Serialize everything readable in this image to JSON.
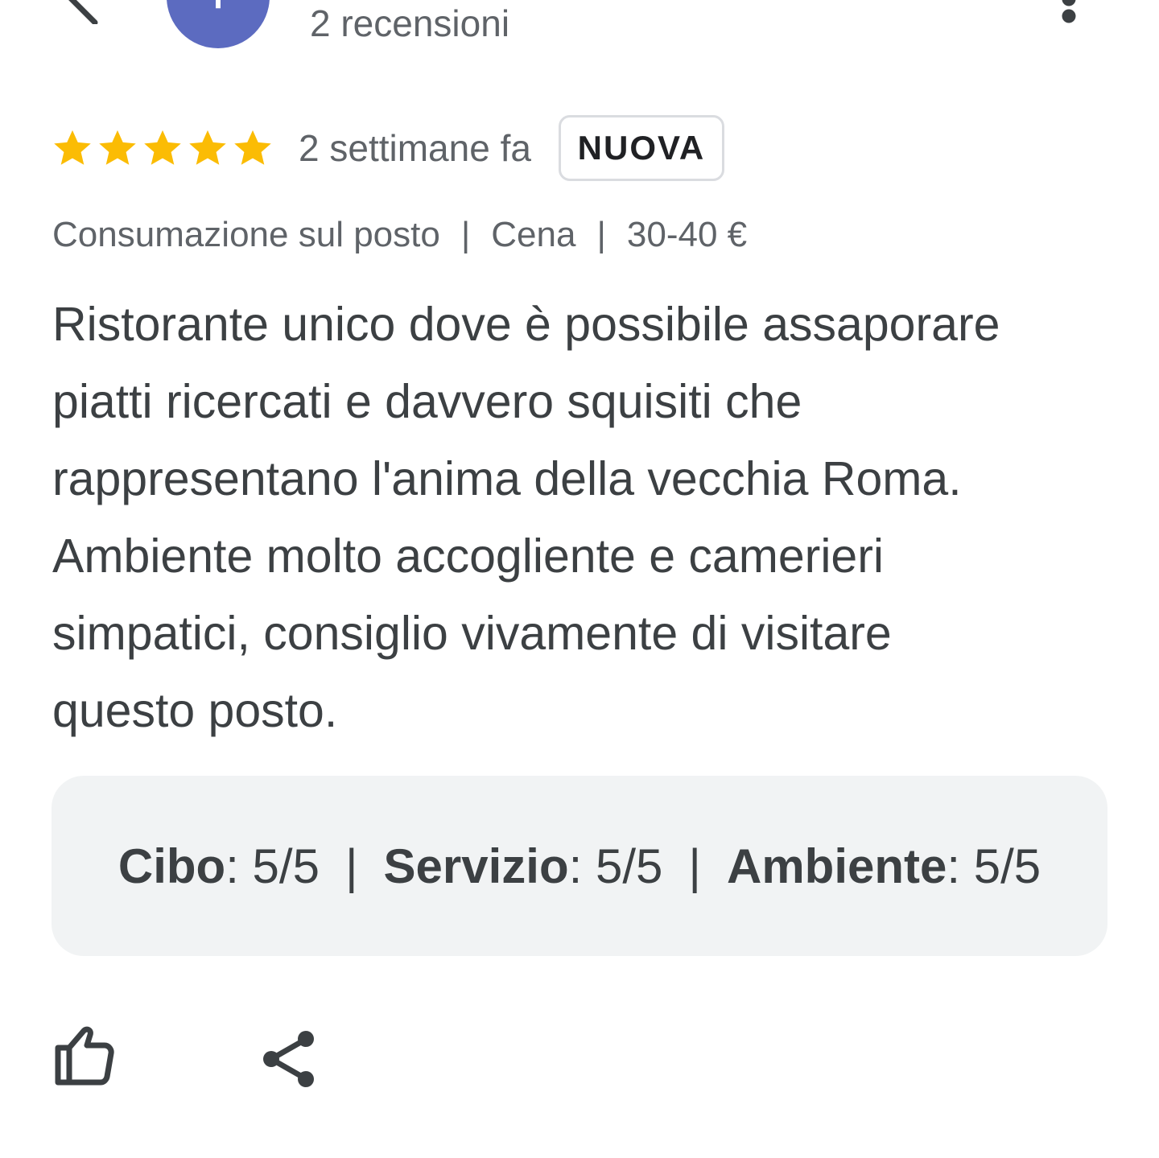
{
  "header": {
    "avatar_initial": "T",
    "reviews_count": "2 recensioni",
    "back_icon": "arrow-back-icon",
    "more_icon": "more-vertical-icon"
  },
  "review": {
    "rating": 5,
    "rating_max": 5,
    "star_color": "#fbbc04",
    "time_ago": "2 settimane fa",
    "badge": "NUOVA",
    "meta": {
      "service": "Consumazione sul posto",
      "meal": "Cena",
      "price": "30-40 €",
      "separator": "|"
    },
    "text": "Ristorante unico dove è possibile assaporare\npiatti ricercati e davvero squisiti che\nrappresentano l'anima della vecchia Roma.\nAmbiente molto accogliente e camerieri\nsimpatici, consiglio vivamente di visitare\nquesto posto.",
    "sub_ratings": {
      "food_label": "Cibo",
      "food_value": ": 5/5",
      "service_label": "Servizio",
      "service_value": ": 5/5",
      "atmosphere_label": "Ambiente",
      "atmosphere_value": ": 5/5",
      "separator": "|"
    }
  },
  "actions": {
    "like_icon": "thumb-up-icon",
    "share_icon": "share-icon"
  },
  "colors": {
    "avatar_bg": "#5c6bc0",
    "text_primary": "#3c4043",
    "text_secondary": "#5f6368",
    "box_bg": "#f1f3f4"
  }
}
